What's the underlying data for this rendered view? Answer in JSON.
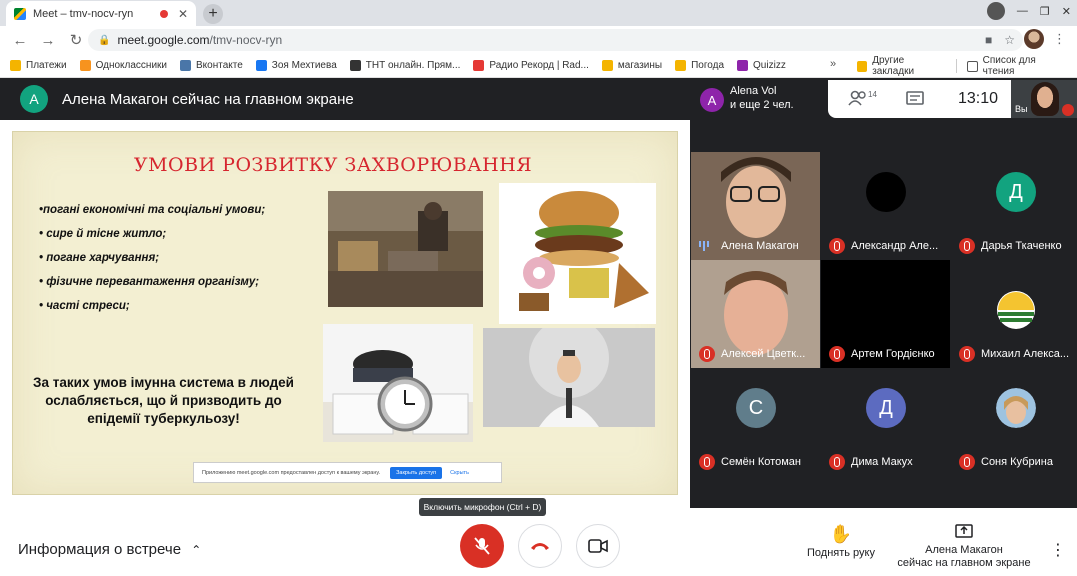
{
  "browser": {
    "tab_title": "Meet – tmv-nocv-ryn",
    "tab_close": "✕",
    "new_tab": "+",
    "url_domain": "meet.google.com",
    "url_path": "/tmv-nocv-ryn",
    "bookmarks": [
      {
        "label": "Платежи",
        "color": "#f4b400"
      },
      {
        "label": "Одноклассники",
        "color": "#f7931e"
      },
      {
        "label": "Вконтакте",
        "color": "#4a76a8"
      },
      {
        "label": "Зоя Мехтиева",
        "color": "#1877f2"
      },
      {
        "label": "ТНТ онлайн. Прям...",
        "color": "#333333"
      },
      {
        "label": "Радио Рекорд | Rad...",
        "color": "#e53935"
      },
      {
        "label": "магазины",
        "color": "#f4b400"
      },
      {
        "label": "Погода",
        "color": "#f4b400"
      },
      {
        "label": "Quizizz",
        "color": "#8e24aa"
      }
    ],
    "bookmarks_more": "»",
    "other_bookmarks": "Другие закладки",
    "reading_list": "Список для чтения"
  },
  "meet": {
    "presenter_initial": "A",
    "presenter_banner": "Алена Макагон сейчас на главном экране",
    "top_user_initial": "A",
    "top_user_name": "Alena Vol",
    "top_user_sub": "и еще 2 чел.",
    "participants_count": "14",
    "clock": "13:10",
    "you_label": "Вы",
    "tooltip": "Включить микрофон (Ctrl + D)",
    "meeting_info": "Информация о встрече",
    "raise_hand": "Поднять руку",
    "present_line1": "Алена Макагон",
    "present_line2": "сейчас на главном экране",
    "accent_red": "#d93025"
  },
  "slide": {
    "title": "УМОВИ РОЗВИТКУ ЗАХВОРЮВАННЯ",
    "bullets": [
      "•погані економічні та соціальні умови;",
      "•  сире й тісне житло;",
      "•  погане харчування;",
      "•  фізичне перевантаження організму;",
      "•  часті стреси;"
    ],
    "conclusion": "За таких умов імунна система в людей ослабляється, що й призводить до епідемії туберкульозу!",
    "share_notice": "Приложению meet.google.com предоставлен доступ к вашему экрану.",
    "share_stop": "Закрыть доступ",
    "share_hide": "Скрыть"
  },
  "tiles": [
    {
      "name": "Алена Макагон",
      "type": "video",
      "initial": ""
    },
    {
      "name": "Александр Але...",
      "type": "blank",
      "initial": ""
    },
    {
      "name": "Дарья Ткаченко",
      "type": "avatar",
      "initial": "Д",
      "color": "#12a37f"
    },
    {
      "name": "Алексей Цветк...",
      "type": "video",
      "initial": ""
    },
    {
      "name": "Артем Гордієнко",
      "type": "black",
      "initial": ""
    },
    {
      "name": "Михаил Алекса...",
      "type": "logo",
      "initial": ""
    },
    {
      "name": "Семён Котоман",
      "type": "avatar",
      "initial": "С",
      "color": "#607d8b"
    },
    {
      "name": "Дима Макух",
      "type": "avatar",
      "initial": "Д",
      "color": "#5c6bc0"
    },
    {
      "name": "Соня Кубрина",
      "type": "photo",
      "initial": ""
    }
  ]
}
